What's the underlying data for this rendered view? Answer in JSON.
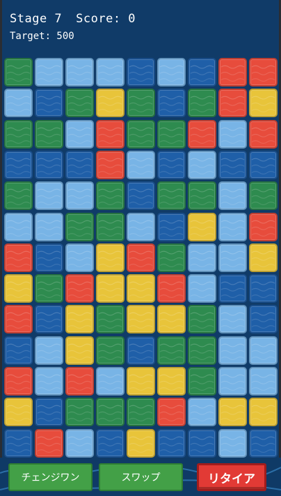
{
  "hud": {
    "stage": "Stage 7",
    "score": "Score: 0",
    "target": "Target: 500"
  },
  "colors": {
    "R": "#e74c3c",
    "G": "#2e8b4f",
    "L": "#78b4e6",
    "D": "#1f5fa8",
    "Y": "#e8c43a"
  },
  "board": {
    "rows": [
      [
        "G",
        "L",
        "L",
        "L",
        "D",
        "L",
        "D",
        "R",
        "R"
      ],
      [
        "L",
        "D",
        "G",
        "Y",
        "G",
        "D",
        "G",
        "R",
        "Y"
      ],
      [
        "G",
        "G",
        "L",
        "R",
        "G",
        "G",
        "R",
        "L",
        "R"
      ],
      [
        "D",
        "D",
        "D",
        "R",
        "L",
        "D",
        "L",
        "D",
        "D"
      ],
      [
        "G",
        "L",
        "L",
        "G",
        "D",
        "G",
        "G",
        "L",
        "G"
      ],
      [
        "L",
        "L",
        "G",
        "G",
        "L",
        "D",
        "Y",
        "L",
        "R"
      ],
      [
        "R",
        "D",
        "L",
        "Y",
        "R",
        "G",
        "L",
        "L",
        "Y"
      ],
      [
        "Y",
        "G",
        "R",
        "Y",
        "Y",
        "R",
        "L",
        "D",
        "D"
      ],
      [
        "R",
        "D",
        "Y",
        "G",
        "Y",
        "Y",
        "G",
        "L",
        "D"
      ],
      [
        "D",
        "L",
        "Y",
        "G",
        "D",
        "G",
        "G",
        "L",
        "L"
      ],
      [
        "R",
        "L",
        "R",
        "L",
        "Y",
        "Y",
        "G",
        "L",
        "L"
      ],
      [
        "Y",
        "D",
        "G",
        "G",
        "G",
        "R",
        "L",
        "Y",
        "Y"
      ],
      [
        "D",
        "R",
        "L",
        "D",
        "Y",
        "D",
        "D",
        "L",
        "D"
      ]
    ]
  },
  "buttons": {
    "change_one": "チェンジワン",
    "swap": "スワップ",
    "retire": "リタイア"
  }
}
